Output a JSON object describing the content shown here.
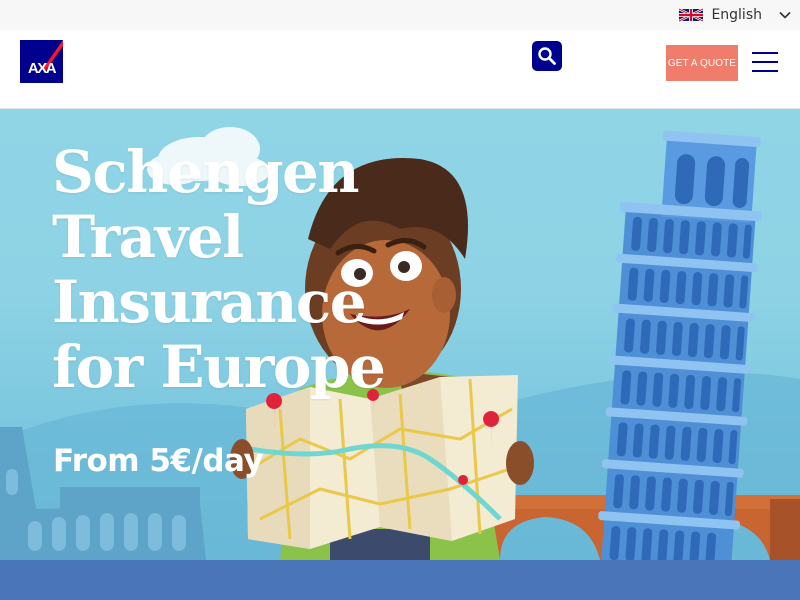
{
  "language_bar": {
    "flag_icon": "uk-flag-icon",
    "language_label": "English",
    "dropdown_icon": "chevron-down-icon"
  },
  "header": {
    "logo_text": "AXA",
    "search_icon": "search-icon",
    "get_quote_label": "GET A QUOTE",
    "menu_icon": "hamburger-menu-icon"
  },
  "hero": {
    "title_lines": [
      "Schengen",
      "Travel",
      "Insurance",
      "for Europe"
    ],
    "price_text": "From 5€/day",
    "illustration": "cartoon-boy-with-map-and-leaning-tower-icon"
  },
  "colors": {
    "brand_blue": "#00008f",
    "brand_red": "#ff1721",
    "quote_button": "#f07c6c",
    "hero_sky": "#8fd5e6",
    "bottom_band": "#4a76b9"
  }
}
